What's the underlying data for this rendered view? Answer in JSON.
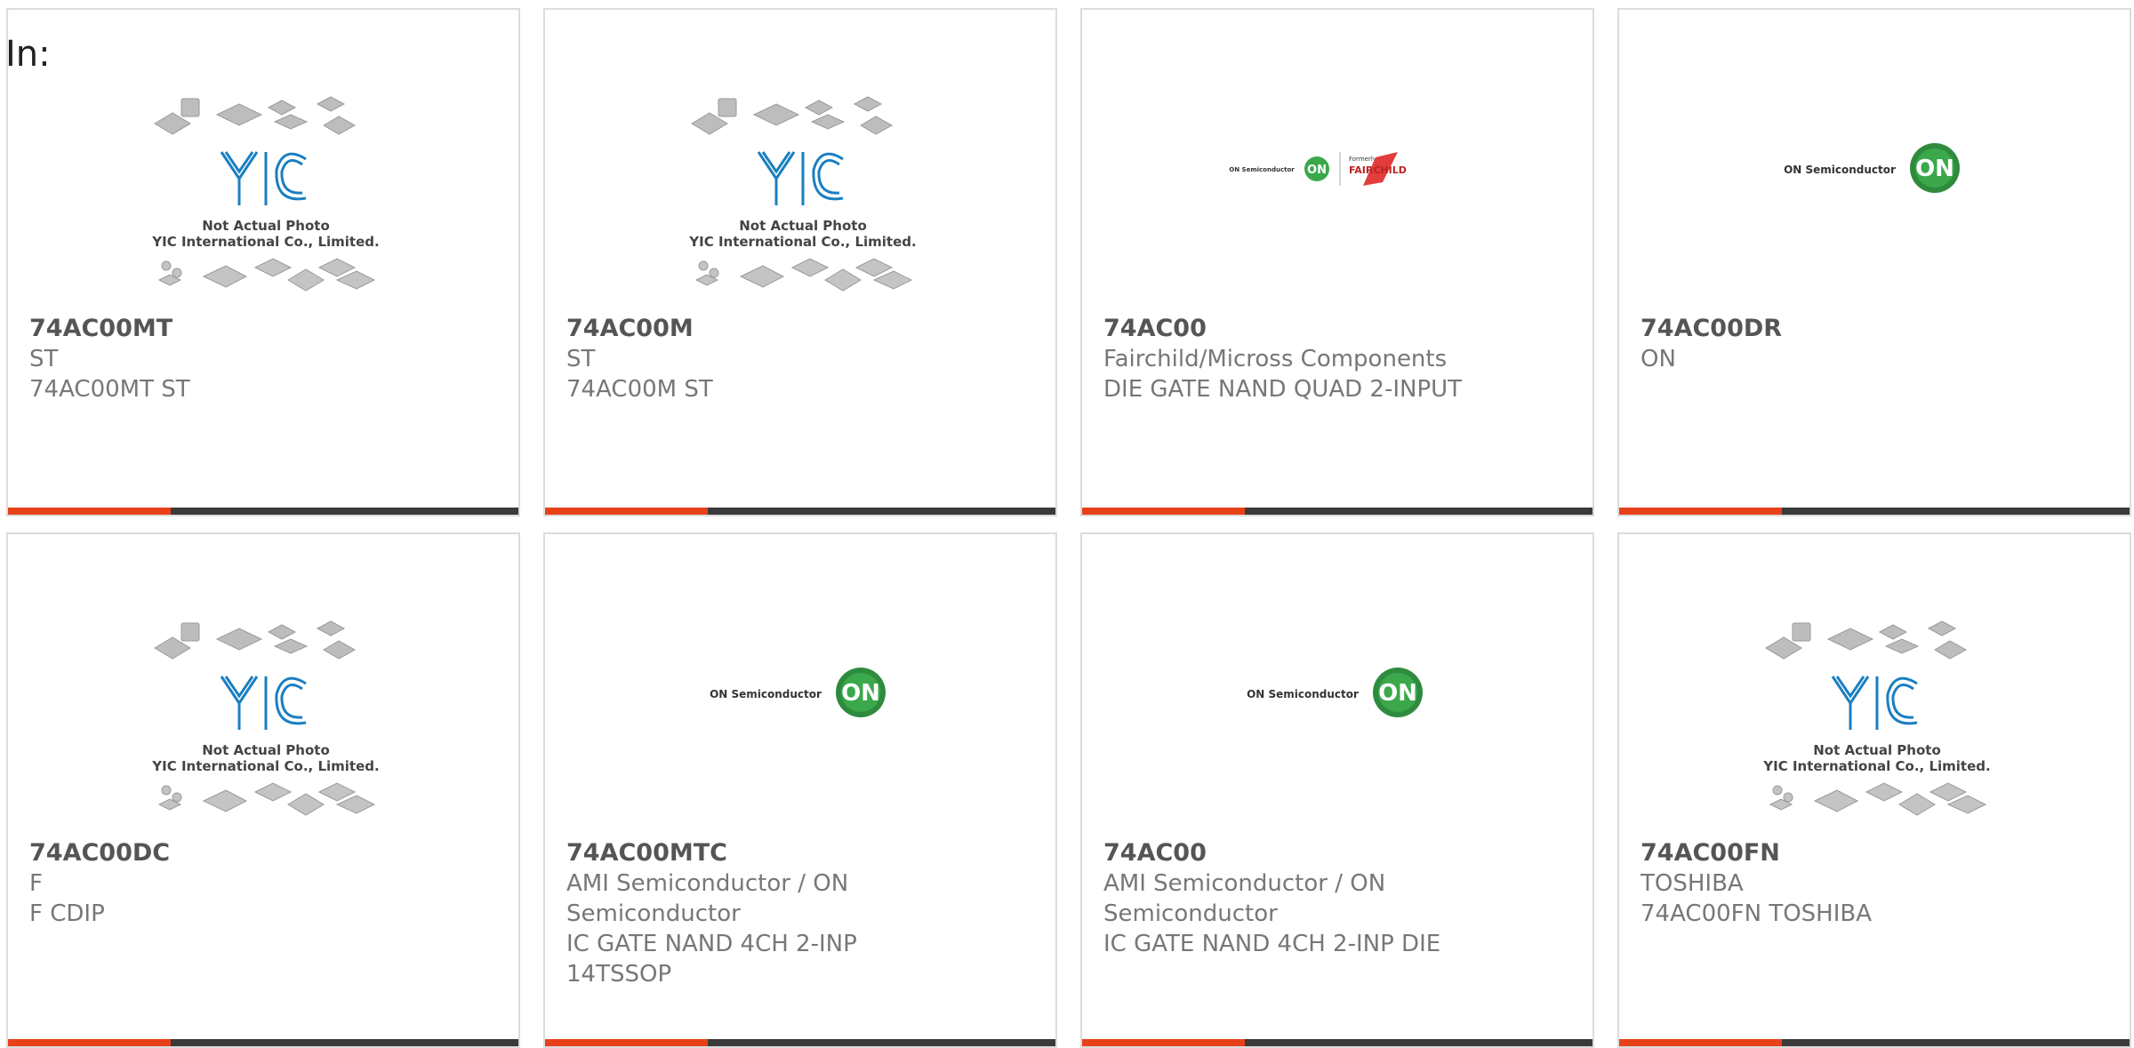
{
  "page": {
    "heading": "In:"
  },
  "logos": {
    "yic": {
      "line1": "Not Actual Photo",
      "line2": "YIC International Co., Limited."
    },
    "on": {
      "name": "ON Semiconductor",
      "badge": "ON"
    },
    "fairchild": {
      "on_name": "ON Semiconductor",
      "formerly": "Formerly",
      "brand": "FAIRCHILD"
    }
  },
  "colors": {
    "accent": "#e8411a",
    "bar": "#3a3a3a",
    "on_green": "#2e8b3e",
    "yic_blue": "#1a7fc1"
  },
  "products": [
    {
      "part": "74AC00MT",
      "lines": [
        "ST",
        "74AC00MT ST"
      ],
      "image": "yic-placeholder"
    },
    {
      "part": "74AC00M",
      "lines": [
        "ST",
        "74AC00M ST"
      ],
      "image": "yic-placeholder"
    },
    {
      "part": "74AC00",
      "lines": [
        "Fairchild/Micross Components",
        "DIE GATE NAND QUAD 2-INPUT"
      ],
      "image": "on-fairchild-logo"
    },
    {
      "part": "74AC00DR",
      "lines": [
        "ON"
      ],
      "image": "on-semiconductor-logo"
    },
    {
      "part": "74AC00DC",
      "lines": [
        "F",
        "F CDIP"
      ],
      "image": "yic-placeholder"
    },
    {
      "part": "74AC00MTC",
      "lines": [
        "AMI Semiconductor / ON",
        "Semiconductor",
        "IC GATE NAND 4CH 2-INP",
        "14TSSOP"
      ],
      "image": "on-semiconductor-logo"
    },
    {
      "part": "74AC00",
      "lines": [
        "AMI Semiconductor / ON",
        "Semiconductor",
        "IC GATE NAND 4CH 2-INP DIE"
      ],
      "image": "on-semiconductor-logo"
    },
    {
      "part": "74AC00FN",
      "lines": [
        "TOSHIBA",
        "74AC00FN TOSHIBA"
      ],
      "image": "yic-placeholder"
    }
  ]
}
